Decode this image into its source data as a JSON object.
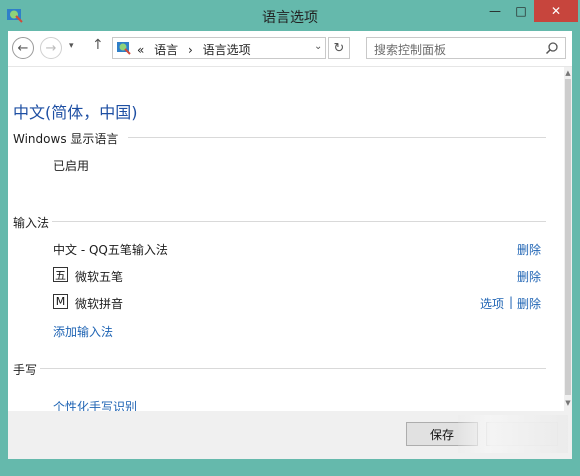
{
  "window": {
    "title": "语言选项",
    "controls": {
      "minimize": "—",
      "maximize": "□",
      "close": "✕"
    }
  },
  "nav": {
    "back": "←",
    "forward": "→",
    "dropdown": "▾",
    "up": "↑",
    "breadcrumb": [
      "«",
      "语言",
      "›",
      "语言选项"
    ],
    "address_dropdown": "⌄",
    "refresh": "↻",
    "search_placeholder": "搜索控制面板"
  },
  "content": {
    "heading": "中文(简体，中国)",
    "display_language": {
      "label": "Windows 显示语言",
      "status": "已启用"
    },
    "input_methods": {
      "label": "输入法",
      "items": [
        {
          "name": "中文 - QQ五笔输入法",
          "icon_text": "",
          "links": [
            "删除"
          ]
        },
        {
          "name": "微软五笔",
          "icon_text": "五",
          "links": [
            "删除"
          ]
        },
        {
          "name": "微软拼音",
          "icon_text": "M",
          "links": [
            "选项",
            "删除"
          ]
        }
      ],
      "separator": "|",
      "add_link": "添加输入法"
    },
    "handwriting": {
      "label": "手写",
      "link": "个性化手写识别"
    }
  },
  "footer": {
    "save_label": "保存"
  }
}
